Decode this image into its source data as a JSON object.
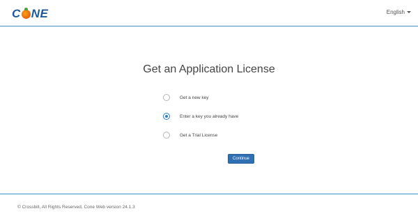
{
  "header": {
    "logo_text": {
      "c": "C",
      "ne": "NE"
    },
    "language": "English"
  },
  "main": {
    "title": "Get an Application License",
    "options": [
      {
        "label": "Get a new key",
        "selected": false
      },
      {
        "label": "Enter a key you already have",
        "selected": true
      },
      {
        "label": "Get a Trial License",
        "selected": false
      }
    ],
    "continue_label": "Continue"
  },
  "footer": {
    "text": "© Crossbill, All Rights Reserved, Cone Web version 24.1.3"
  },
  "colors": {
    "accent": "#2f6fb3",
    "divider": "#3f8fc6",
    "logo": "#1e5a9a",
    "logo_orange": "#e8620c"
  },
  "icons": [
    "cone-logo-icon",
    "caret-down-icon"
  ]
}
